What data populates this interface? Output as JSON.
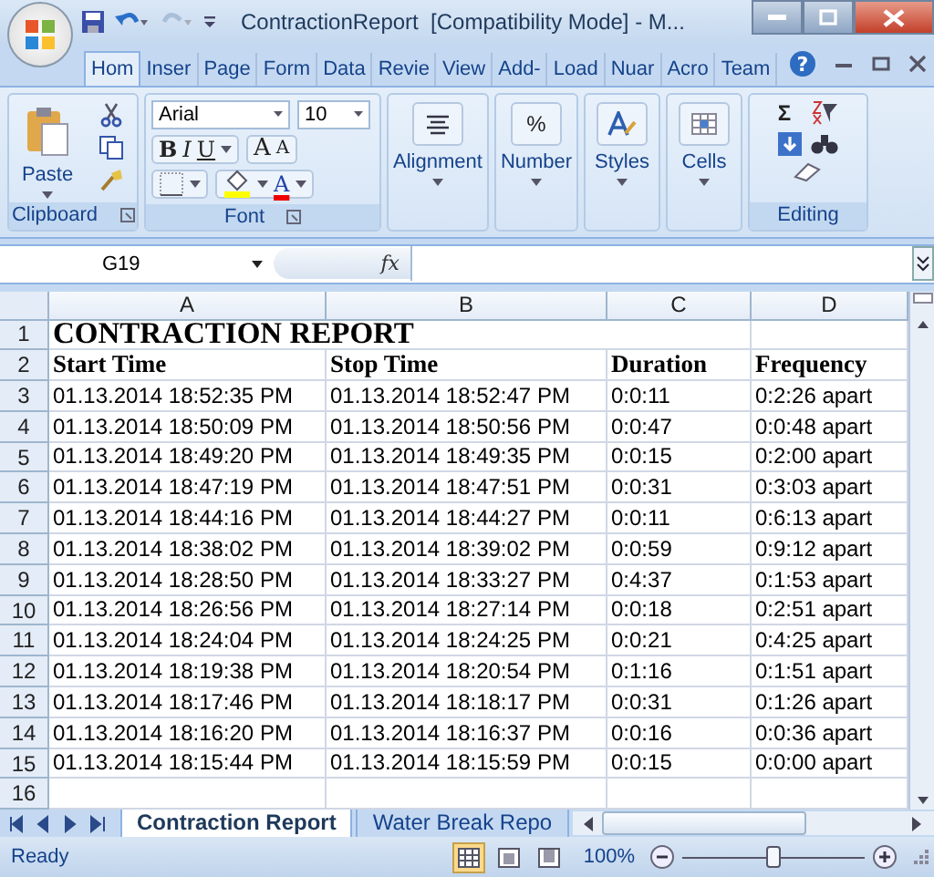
{
  "window": {
    "title": "ContractionReport  [Compatibility Mode] - M..."
  },
  "ribbon_tabs": [
    {
      "label": "Hom",
      "selected": true
    },
    {
      "label": "Inser",
      "selected": false
    },
    {
      "label": "Page",
      "selected": false
    },
    {
      "label": "Form",
      "selected": false
    },
    {
      "label": "Data",
      "selected": false
    },
    {
      "label": "Revie",
      "selected": false
    },
    {
      "label": "View",
      "selected": false
    },
    {
      "label": "Add-",
      "selected": false
    },
    {
      "label": "Load",
      "selected": false
    },
    {
      "label": "Nuar",
      "selected": false
    },
    {
      "label": "Acro",
      "selected": false
    },
    {
      "label": "Team",
      "selected": false
    }
  ],
  "help": "?",
  "clipboard": {
    "paste": "Paste",
    "group": "Clipboard"
  },
  "font": {
    "name": "Arial",
    "size": "10",
    "bold": "B",
    "italic": "I",
    "underline": "U",
    "grow": "A",
    "shrink": "A",
    "font_color": "A",
    "group": "Font"
  },
  "alignment": {
    "label": "Alignment"
  },
  "number": {
    "symbol": "%",
    "label": "Number"
  },
  "styles": {
    "label": "Styles"
  },
  "cells": {
    "label": "Cells"
  },
  "editing": {
    "sum": "Σ",
    "group": "Editing"
  },
  "formula_bar": {
    "name_box": "G19",
    "fx": "fx"
  },
  "columns": [
    "A",
    "B",
    "C",
    "D"
  ],
  "rows": [
    {
      "number": "1",
      "kind": "title",
      "cells": [
        "CONTRACTION REPORT"
      ]
    },
    {
      "number": "2",
      "kind": "header",
      "cells": [
        "Start Time",
        "Stop Time",
        "Duration",
        "Frequency"
      ]
    },
    {
      "number": "3",
      "kind": "data",
      "cells": [
        "01.13.2014 18:52:35 PM",
        "01.13.2014 18:52:47 PM",
        "0:0:11",
        "0:2:26 apart"
      ]
    },
    {
      "number": "4",
      "kind": "data",
      "cells": [
        "01.13.2014 18:50:09 PM",
        "01.13.2014 18:50:56 PM",
        "0:0:47",
        "0:0:48 apart"
      ]
    },
    {
      "number": "5",
      "kind": "data",
      "cells": [
        "01.13.2014 18:49:20 PM",
        "01.13.2014 18:49:35 PM",
        "0:0:15",
        "0:2:00 apart"
      ]
    },
    {
      "number": "6",
      "kind": "data",
      "cells": [
        "01.13.2014 18:47:19 PM",
        "01.13.2014 18:47:51 PM",
        "0:0:31",
        "0:3:03 apart"
      ]
    },
    {
      "number": "7",
      "kind": "data",
      "cells": [
        "01.13.2014 18:44:16 PM",
        "01.13.2014 18:44:27 PM",
        "0:0:11",
        "0:6:13 apart"
      ]
    },
    {
      "number": "8",
      "kind": "data",
      "cells": [
        "01.13.2014 18:38:02 PM",
        "01.13.2014 18:39:02 PM",
        "0:0:59",
        "0:9:12 apart"
      ]
    },
    {
      "number": "9",
      "kind": "data",
      "cells": [
        "01.13.2014 18:28:50 PM",
        "01.13.2014 18:33:27 PM",
        "0:4:37",
        "0:1:53 apart"
      ]
    },
    {
      "number": "10",
      "kind": "data",
      "cells": [
        "01.13.2014 18:26:56 PM",
        "01.13.2014 18:27:14 PM",
        "0:0:18",
        "0:2:51 apart"
      ]
    },
    {
      "number": "11",
      "kind": "data",
      "cells": [
        "01.13.2014 18:24:04 PM",
        "01.13.2014 18:24:25 PM",
        "0:0:21",
        "0:4:25 apart"
      ]
    },
    {
      "number": "12",
      "kind": "data",
      "cells": [
        "01.13.2014 18:19:38 PM",
        "01.13.2014 18:20:54 PM",
        "0:1:16",
        "0:1:51 apart"
      ]
    },
    {
      "number": "13",
      "kind": "data",
      "cells": [
        "01.13.2014 18:17:46 PM",
        "01.13.2014 18:18:17 PM",
        "0:0:31",
        "0:1:26 apart"
      ]
    },
    {
      "number": "14",
      "kind": "data",
      "cells": [
        "01.13.2014 18:16:20 PM",
        "01.13.2014 18:16:37 PM",
        "0:0:16",
        "0:0:36 apart"
      ]
    },
    {
      "number": "15",
      "kind": "data",
      "cells": [
        "01.13.2014 18:15:44 PM",
        "01.13.2014 18:15:59 PM",
        "0:0:15",
        "0:0:00 apart"
      ]
    },
    {
      "number": "16",
      "kind": "data",
      "cells": []
    }
  ],
  "sheet_tabs": [
    {
      "label": "Contraction Report",
      "selected": true
    },
    {
      "label": "Water Break Repo",
      "selected": false
    }
  ],
  "status_bar": {
    "status": "Ready",
    "views": [
      {
        "kind": "normal",
        "selected": true
      },
      {
        "kind": "layout",
        "selected": false
      },
      {
        "kind": "break",
        "selected": false
      }
    ],
    "zoom": "100%",
    "zoom_slider": {
      "level": 0.5
    }
  }
}
